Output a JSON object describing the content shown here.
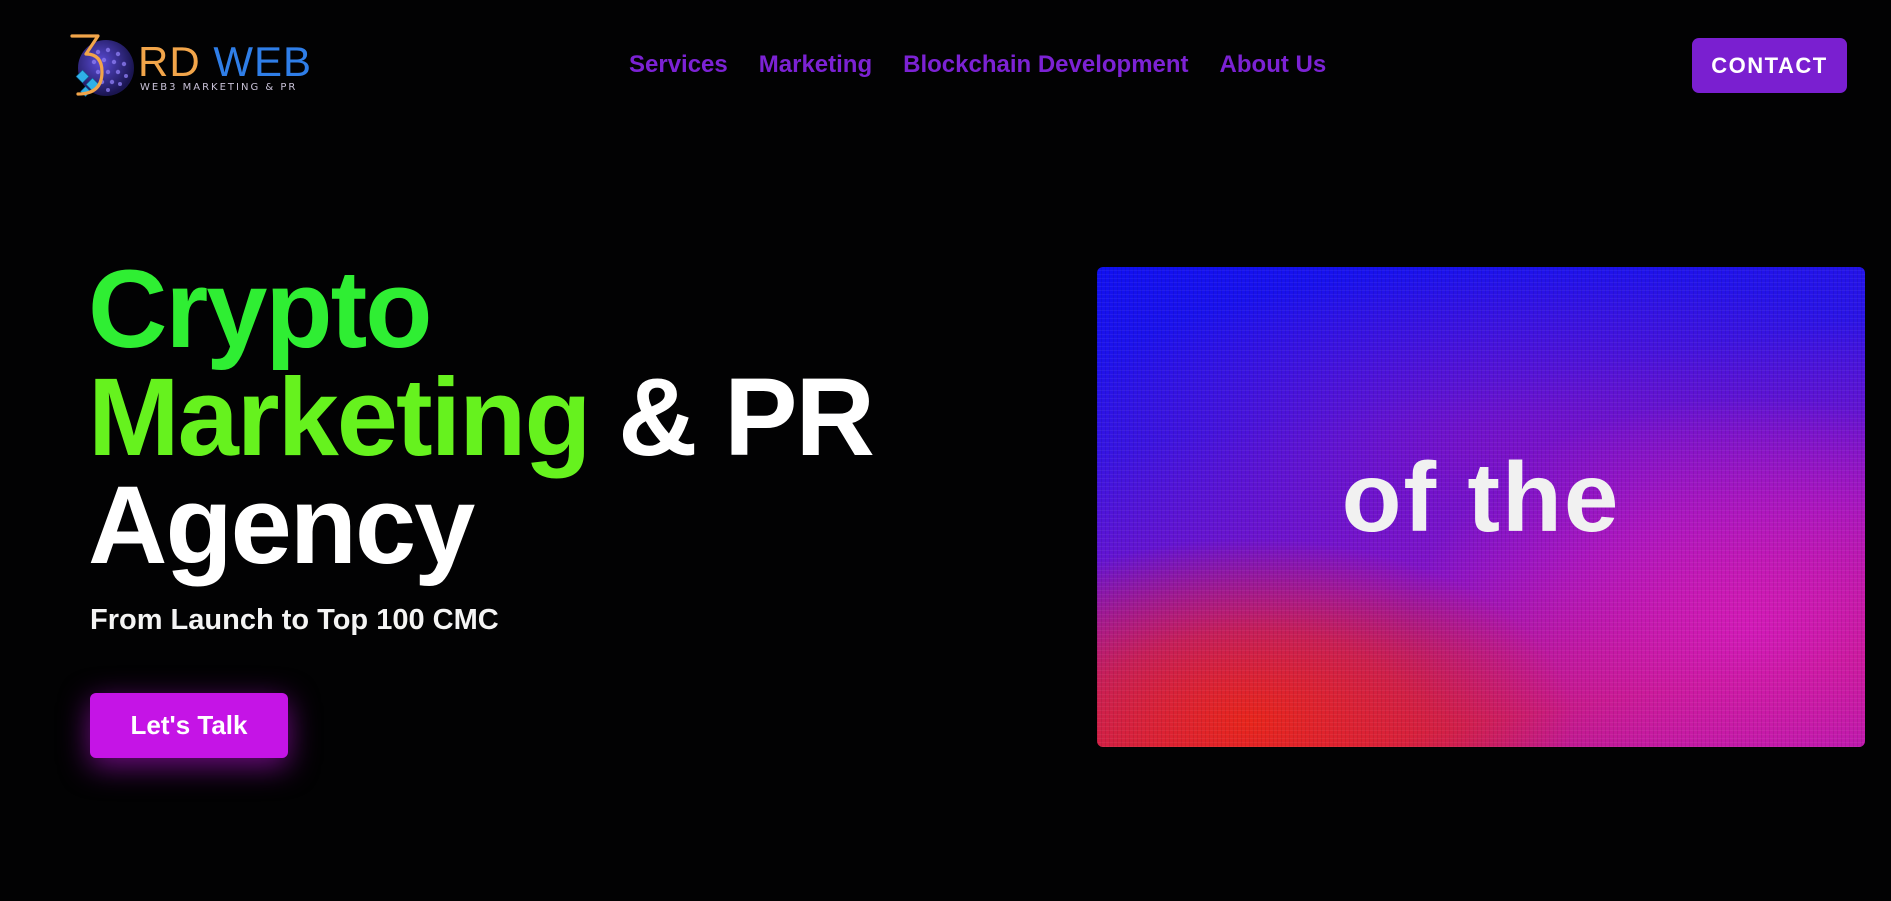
{
  "header": {
    "logo": {
      "wordmark_rd": "RD",
      "wordmark_web": "WEB",
      "tagline": "WEB3 MARKETING & PR"
    },
    "nav": [
      {
        "label": "Services"
      },
      {
        "label": "Marketing"
      },
      {
        "label": "Blockchain Development"
      },
      {
        "label": "About Us"
      }
    ],
    "contact_label": "CONTACT"
  },
  "hero": {
    "title_line1": "Crypto",
    "title_line2_green": "Marketing",
    "title_line2_white": "& PR",
    "title_line3": "Agency",
    "subtitle": "From Launch to Top 100 CMC",
    "cta_label": "Let's Talk"
  },
  "video": {
    "caption": "of the"
  },
  "colors": {
    "background": "#020203",
    "nav_purple": "#7c22d4",
    "contact_bg": "#7a1fd0",
    "crypto_green": "#2fee33",
    "marketing_green": "#66f21e",
    "cta_magenta": "#c514e6",
    "logo_orange": "#f2a54a",
    "logo_blue": "#2f7ee8"
  },
  "icons": {
    "logo_mark": "3-globe-logo-icon"
  }
}
